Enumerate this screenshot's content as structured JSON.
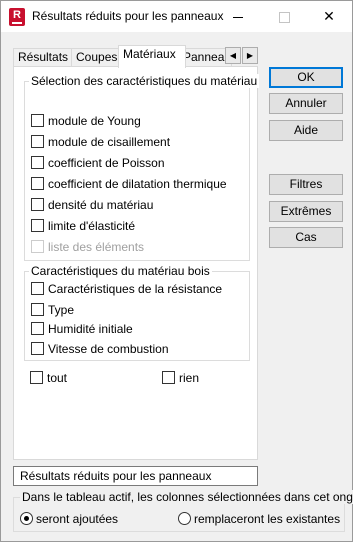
{
  "window": {
    "title": "Résultats réduits pour les panneaux",
    "app_icon_letter": "R",
    "controls": {
      "minimize": "–",
      "maximize": "□",
      "close": "✕"
    }
  },
  "tabs": {
    "items": [
      "Résultats",
      "Coupes",
      "Matériaux",
      "Panneaux"
    ],
    "active": "Matériaux",
    "scroll_left": "◀",
    "scroll_right": "▶"
  },
  "material_selection": {
    "title": "Sélection des caractéristiques du matériau",
    "items": [
      {
        "label": "module de Young",
        "checked": false,
        "enabled": true
      },
      {
        "label": "module de cisaillement",
        "checked": false,
        "enabled": true
      },
      {
        "label": "coefficient de Poisson",
        "checked": false,
        "enabled": true
      },
      {
        "label": "coefficient de dilatation thermique",
        "checked": false,
        "enabled": true
      },
      {
        "label": "densité du matériau",
        "checked": false,
        "enabled": true
      },
      {
        "label": "limite d'élasticité",
        "checked": false,
        "enabled": true
      },
      {
        "label": "liste des éléments",
        "checked": false,
        "enabled": false
      }
    ]
  },
  "wood_group": {
    "title": "Caractéristiques du matériau bois",
    "items": [
      {
        "label": "Caractéristiques de la résistance",
        "checked": false
      },
      {
        "label": "Type",
        "checked": false
      },
      {
        "label": "Humidité initiale",
        "checked": false
      },
      {
        "label": "Vitesse de combustion",
        "checked": false
      }
    ]
  },
  "select_all": {
    "all_label": "tout",
    "none_label": "rien"
  },
  "buttons": {
    "ok": "OK",
    "cancel": "Annuler",
    "help": "Aide",
    "filters": "Filtres",
    "extremes": "Extrêmes",
    "cases": "Cas"
  },
  "table_name": "Résultats réduits pour les panneaux",
  "columns_group": {
    "title": "Dans le tableau actif, les colonnes sélectionnées dans cet onglet",
    "option_added": "seront ajoutées",
    "option_replace": "remplaceront les existantes",
    "selected": "option_added"
  }
}
